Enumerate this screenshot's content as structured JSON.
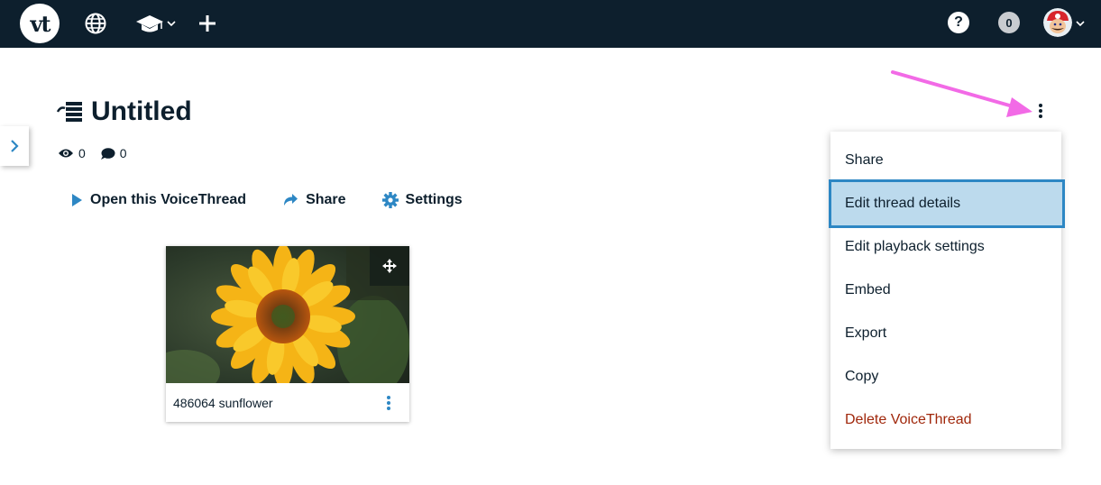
{
  "header": {
    "logo_text": "vt",
    "help_label": "?",
    "notification_count": "0"
  },
  "thread": {
    "title": "Untitled",
    "views": "0",
    "comments": "0"
  },
  "actions": {
    "open_label": "Open this VoiceThread",
    "share_label": "Share",
    "settings_label": "Settings"
  },
  "card": {
    "label": "486064 sunflower"
  },
  "menu": {
    "items": [
      {
        "label": "Share"
      },
      {
        "label": "Edit thread details"
      },
      {
        "label": "Edit playback settings"
      },
      {
        "label": "Embed"
      },
      {
        "label": "Export"
      },
      {
        "label": "Copy"
      },
      {
        "label": "Delete VoiceThread"
      }
    ]
  },
  "colors": {
    "topbar": "#0d1f2d",
    "accent": "#2d87c4",
    "selected_bg": "#bcdaed",
    "danger": "#a0270b",
    "annotation_arrow": "#f26ae6"
  }
}
